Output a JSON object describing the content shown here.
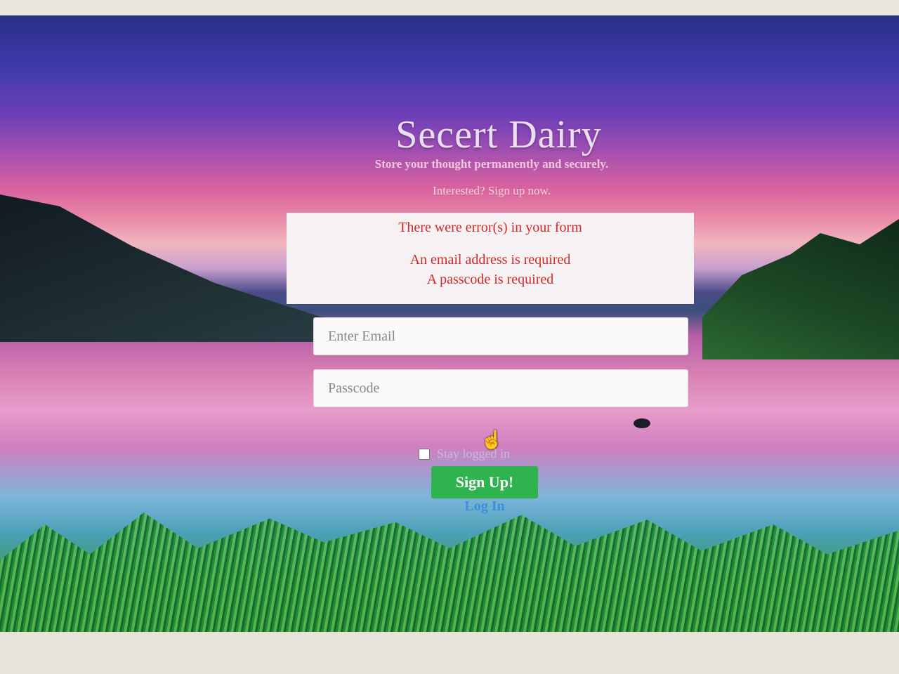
{
  "page": {
    "title": "Secert Dairy",
    "tagline": "Store your thought permanently and securely.",
    "interested": "Interested? Sign up now."
  },
  "errors": {
    "heading": "There were error(s) in your form",
    "messages": [
      "An email address is required",
      "A passcode is required"
    ]
  },
  "form": {
    "email_placeholder": "Enter Email",
    "passcode_placeholder": "Passcode",
    "stay_logged_in_label": "Stay logged in",
    "stay_logged_in_checked": false,
    "signup_label": "Sign Up!",
    "login_link": "Log In"
  },
  "colors": {
    "error_text": "#d22a2a",
    "signup_button": "#2eb34f",
    "login_link": "#3a90d8"
  }
}
